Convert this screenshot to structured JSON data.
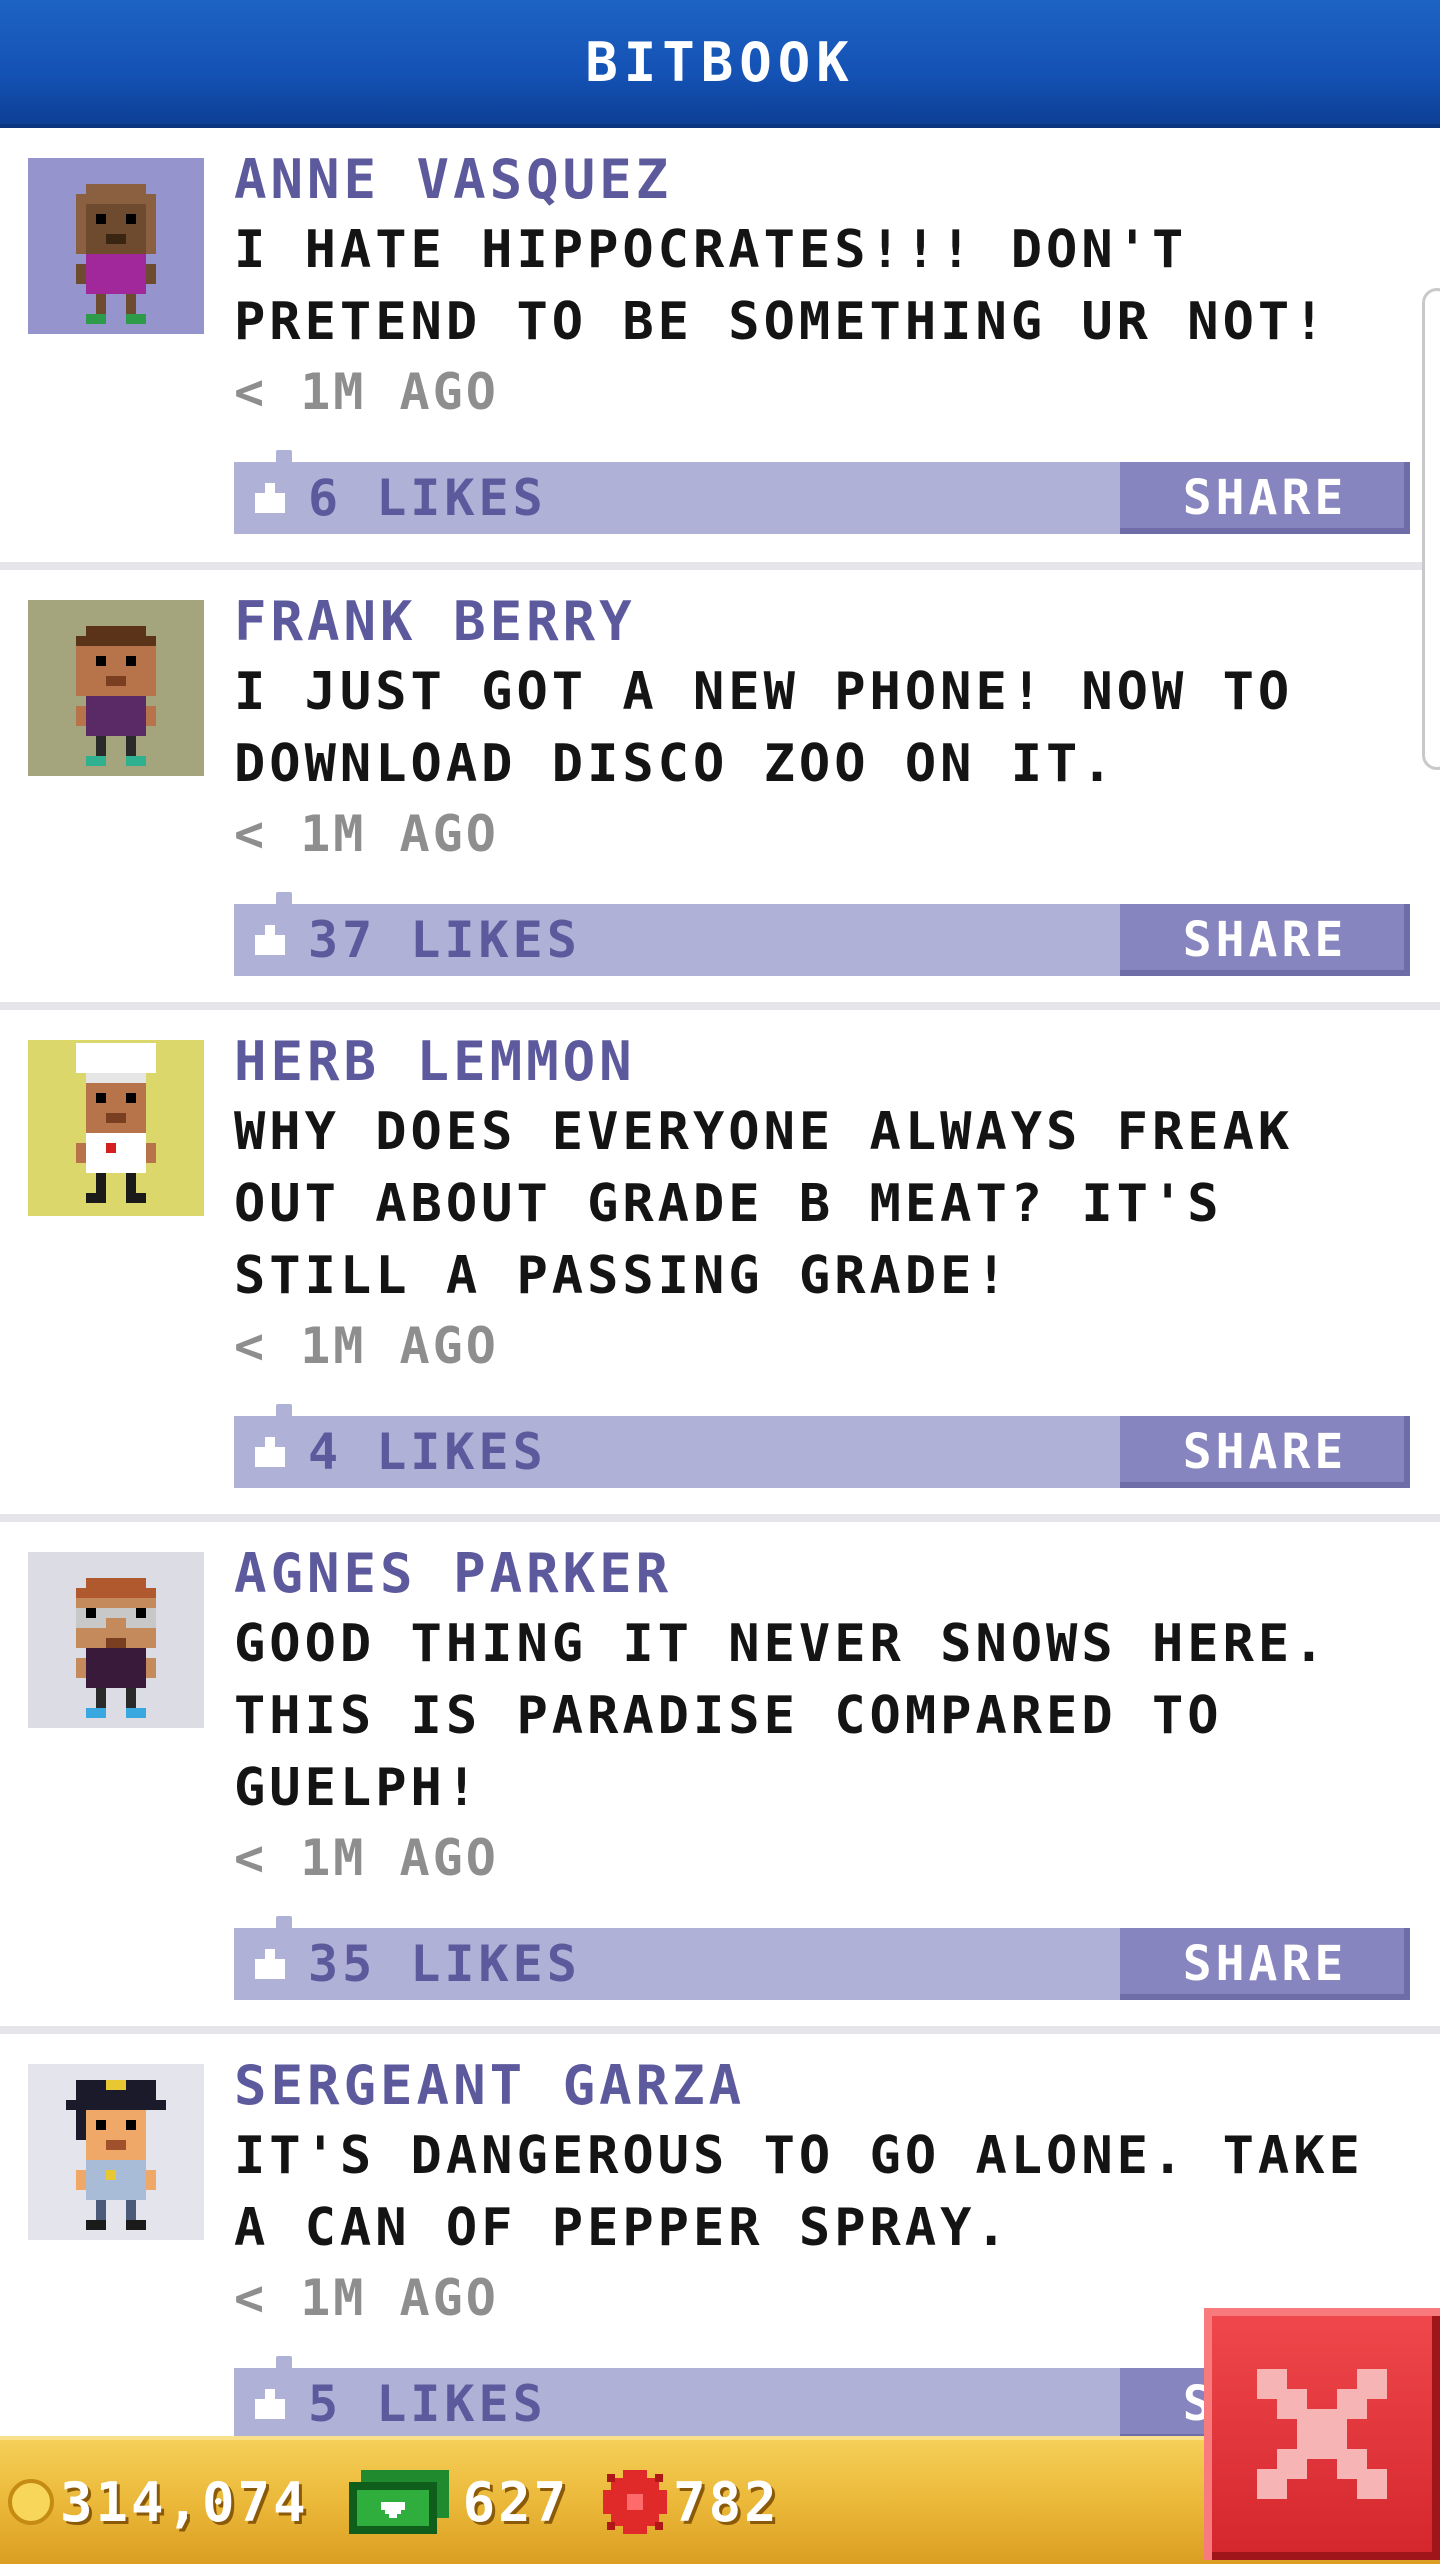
{
  "header": {
    "title": "BITBOOK"
  },
  "posts": [
    {
      "name": "ANNE VASQUEZ",
      "text": "I HATE HIPPOCRATES!!! DON'T PRETEND TO BE SOMETHING UR NOT!",
      "time": "< 1M AGO",
      "likes": "6 LIKES",
      "share": "SHARE",
      "avatar_bg": "#9594cc"
    },
    {
      "name": "FRANK BERRY",
      "text": "I JUST GOT A NEW PHONE! NOW TO DOWNLOAD DISCO ZOO ON IT.",
      "time": "< 1M AGO",
      "likes": "37 LIKES",
      "share": "SHARE",
      "avatar_bg": "#a4a57c"
    },
    {
      "name": "HERB LEMMON",
      "text": "WHY DOES EVERYONE ALWAYS FREAK OUT ABOUT GRADE B MEAT? IT'S STILL A PASSING GRADE!",
      "time": "< 1M AGO",
      "likes": "4 LIKES",
      "share": "SHARE",
      "avatar_bg": "#dcd76a"
    },
    {
      "name": "AGNES PARKER",
      "text": "GOOD THING IT NEVER SNOWS HERE. THIS IS PARADISE COMPARED TO GUELPH!",
      "time": "< 1M AGO",
      "likes": "35 LIKES",
      "share": "SHARE",
      "avatar_bg": "#dcdce4"
    },
    {
      "name": "SERGEANT GARZA",
      "text": "IT'S DANGEROUS TO GO ALONE. TAKE A CAN OF PEPPER SPRAY.",
      "time": "< 1M AGO",
      "likes": "5 LIKES",
      "share": "SHARE",
      "avatar_bg": "#e4e4ec"
    }
  ],
  "footer": {
    "coins": "314,074",
    "cash": "627",
    "gems": "782"
  },
  "colors": {
    "header_blue": "#1452b4",
    "name_purple": "#5c5a9c",
    "bar_lavender": "#b0b1d7",
    "share_purple": "#8785bf",
    "footer_gold": "#eab637",
    "close_red": "#e0353a"
  },
  "icons": {
    "like": "thumbs-up-icon",
    "coin": "coin-icon",
    "cash": "cash-icon",
    "gem": "gem-icon",
    "close": "close-x-icon"
  }
}
